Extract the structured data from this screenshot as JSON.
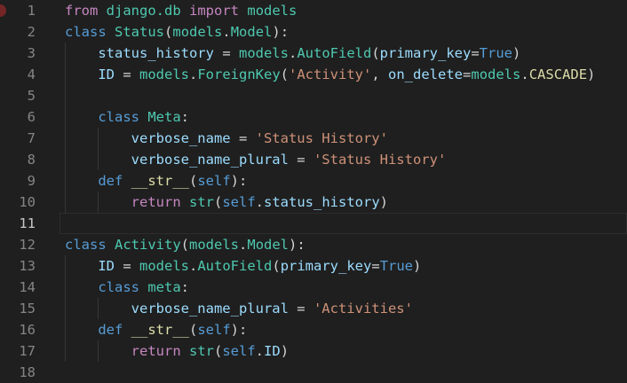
{
  "editor": {
    "background": "#1f1f1f",
    "gutter_color": "#858585",
    "active_gutter_color": "#c6c6c6",
    "indent_guide_color": "#363636",
    "line_highlight_border": "#2d2d2d",
    "breakpoint_color": "#742626",
    "active_line": 11,
    "breakpoint_line": 1,
    "line_height": 24,
    "palette": {
      "plain": "#d4d4d4",
      "keyword": "#569cd6",
      "control": "#c586c0",
      "type": "#4ec9b0",
      "variable": "#9cdcfe",
      "string": "#ce9178",
      "function": "#dcdcaa"
    },
    "lines": [
      {
        "num": "1",
        "guides": 0,
        "tokens": [
          [
            "control",
            "from"
          ],
          [
            "plain",
            " "
          ],
          [
            "type",
            "django.db"
          ],
          [
            "plain",
            " "
          ],
          [
            "control",
            "import"
          ],
          [
            "plain",
            " "
          ],
          [
            "type",
            "models"
          ]
        ]
      },
      {
        "num": "2",
        "guides": 0,
        "tokens": [
          [
            "keyword",
            "class"
          ],
          [
            "plain",
            " "
          ],
          [
            "type",
            "Status"
          ],
          [
            "plain",
            "("
          ],
          [
            "type",
            "models"
          ],
          [
            "plain",
            "."
          ],
          [
            "type",
            "Model"
          ],
          [
            "plain",
            "):"
          ]
        ]
      },
      {
        "num": "3",
        "guides": 1,
        "tokens": [
          [
            "plain",
            "    "
          ],
          [
            "variable",
            "status_history"
          ],
          [
            "plain",
            " = "
          ],
          [
            "type",
            "models"
          ],
          [
            "plain",
            "."
          ],
          [
            "type",
            "AutoField"
          ],
          [
            "plain",
            "("
          ],
          [
            "variable",
            "primary_key"
          ],
          [
            "plain",
            "="
          ],
          [
            "keyword",
            "True"
          ],
          [
            "plain",
            ")"
          ]
        ]
      },
      {
        "num": "4",
        "guides": 1,
        "tokens": [
          [
            "plain",
            "    "
          ],
          [
            "variable",
            "ID"
          ],
          [
            "plain",
            " = "
          ],
          [
            "type",
            "models"
          ],
          [
            "plain",
            "."
          ],
          [
            "type",
            "ForeignKey"
          ],
          [
            "plain",
            "("
          ],
          [
            "string",
            "'Activity'"
          ],
          [
            "plain",
            ", "
          ],
          [
            "variable",
            "on_delete"
          ],
          [
            "plain",
            "="
          ],
          [
            "type",
            "models"
          ],
          [
            "plain",
            "."
          ],
          [
            "function",
            "CASCADE"
          ],
          [
            "plain",
            ")"
          ]
        ]
      },
      {
        "num": "5",
        "guides": 1,
        "tokens": []
      },
      {
        "num": "6",
        "guides": 1,
        "tokens": [
          [
            "plain",
            "    "
          ],
          [
            "keyword",
            "class"
          ],
          [
            "plain",
            " "
          ],
          [
            "type",
            "Meta"
          ],
          [
            "plain",
            ":"
          ]
        ]
      },
      {
        "num": "7",
        "guides": 2,
        "tokens": [
          [
            "plain",
            "        "
          ],
          [
            "variable",
            "verbose_name"
          ],
          [
            "plain",
            " = "
          ],
          [
            "string",
            "'Status History'"
          ]
        ]
      },
      {
        "num": "8",
        "guides": 2,
        "tokens": [
          [
            "plain",
            "        "
          ],
          [
            "variable",
            "verbose_name_plural"
          ],
          [
            "plain",
            " = "
          ],
          [
            "string",
            "'Status History'"
          ]
        ]
      },
      {
        "num": "9",
        "guides": 1,
        "tokens": [
          [
            "plain",
            "    "
          ],
          [
            "keyword",
            "def"
          ],
          [
            "plain",
            " "
          ],
          [
            "function",
            "__str__"
          ],
          [
            "plain",
            "("
          ],
          [
            "keyword",
            "self"
          ],
          [
            "plain",
            "):"
          ]
        ]
      },
      {
        "num": "10",
        "guides": 2,
        "tokens": [
          [
            "plain",
            "        "
          ],
          [
            "control",
            "return"
          ],
          [
            "plain",
            " "
          ],
          [
            "type",
            "str"
          ],
          [
            "plain",
            "("
          ],
          [
            "keyword",
            "self"
          ],
          [
            "plain",
            "."
          ],
          [
            "variable",
            "status_history"
          ],
          [
            "plain",
            ")"
          ]
        ]
      },
      {
        "num": "11",
        "guides": 0,
        "tokens": []
      },
      {
        "num": "12",
        "guides": 0,
        "tokens": [
          [
            "keyword",
            "class"
          ],
          [
            "plain",
            " "
          ],
          [
            "type",
            "Activity"
          ],
          [
            "plain",
            "("
          ],
          [
            "type",
            "models"
          ],
          [
            "plain",
            "."
          ],
          [
            "type",
            "Model"
          ],
          [
            "plain",
            "):"
          ]
        ]
      },
      {
        "num": "13",
        "guides": 1,
        "tokens": [
          [
            "plain",
            "    "
          ],
          [
            "variable",
            "ID"
          ],
          [
            "plain",
            " = "
          ],
          [
            "type",
            "models"
          ],
          [
            "plain",
            "."
          ],
          [
            "type",
            "AutoField"
          ],
          [
            "plain",
            "("
          ],
          [
            "variable",
            "primary_key"
          ],
          [
            "plain",
            "="
          ],
          [
            "keyword",
            "True"
          ],
          [
            "plain",
            ")"
          ]
        ]
      },
      {
        "num": "14",
        "guides": 1,
        "tokens": [
          [
            "plain",
            "    "
          ],
          [
            "keyword",
            "class"
          ],
          [
            "plain",
            " "
          ],
          [
            "type",
            "meta"
          ],
          [
            "plain",
            ":"
          ]
        ]
      },
      {
        "num": "15",
        "guides": 2,
        "tokens": [
          [
            "plain",
            "        "
          ],
          [
            "variable",
            "verbose_name_plural"
          ],
          [
            "plain",
            " = "
          ],
          [
            "string",
            "'Activities'"
          ]
        ]
      },
      {
        "num": "16",
        "guides": 1,
        "tokens": [
          [
            "plain",
            "    "
          ],
          [
            "keyword",
            "def"
          ],
          [
            "plain",
            " "
          ],
          [
            "function",
            "__str__"
          ],
          [
            "plain",
            "("
          ],
          [
            "keyword",
            "self"
          ],
          [
            "plain",
            "):"
          ]
        ]
      },
      {
        "num": "17",
        "guides": 2,
        "tokens": [
          [
            "plain",
            "        "
          ],
          [
            "control",
            "return"
          ],
          [
            "plain",
            " "
          ],
          [
            "type",
            "str"
          ],
          [
            "plain",
            "("
          ],
          [
            "keyword",
            "self"
          ],
          [
            "plain",
            "."
          ],
          [
            "variable",
            "ID"
          ],
          [
            "plain",
            ")"
          ]
        ]
      },
      {
        "num": "18",
        "guides": 0,
        "tokens": []
      }
    ]
  }
}
